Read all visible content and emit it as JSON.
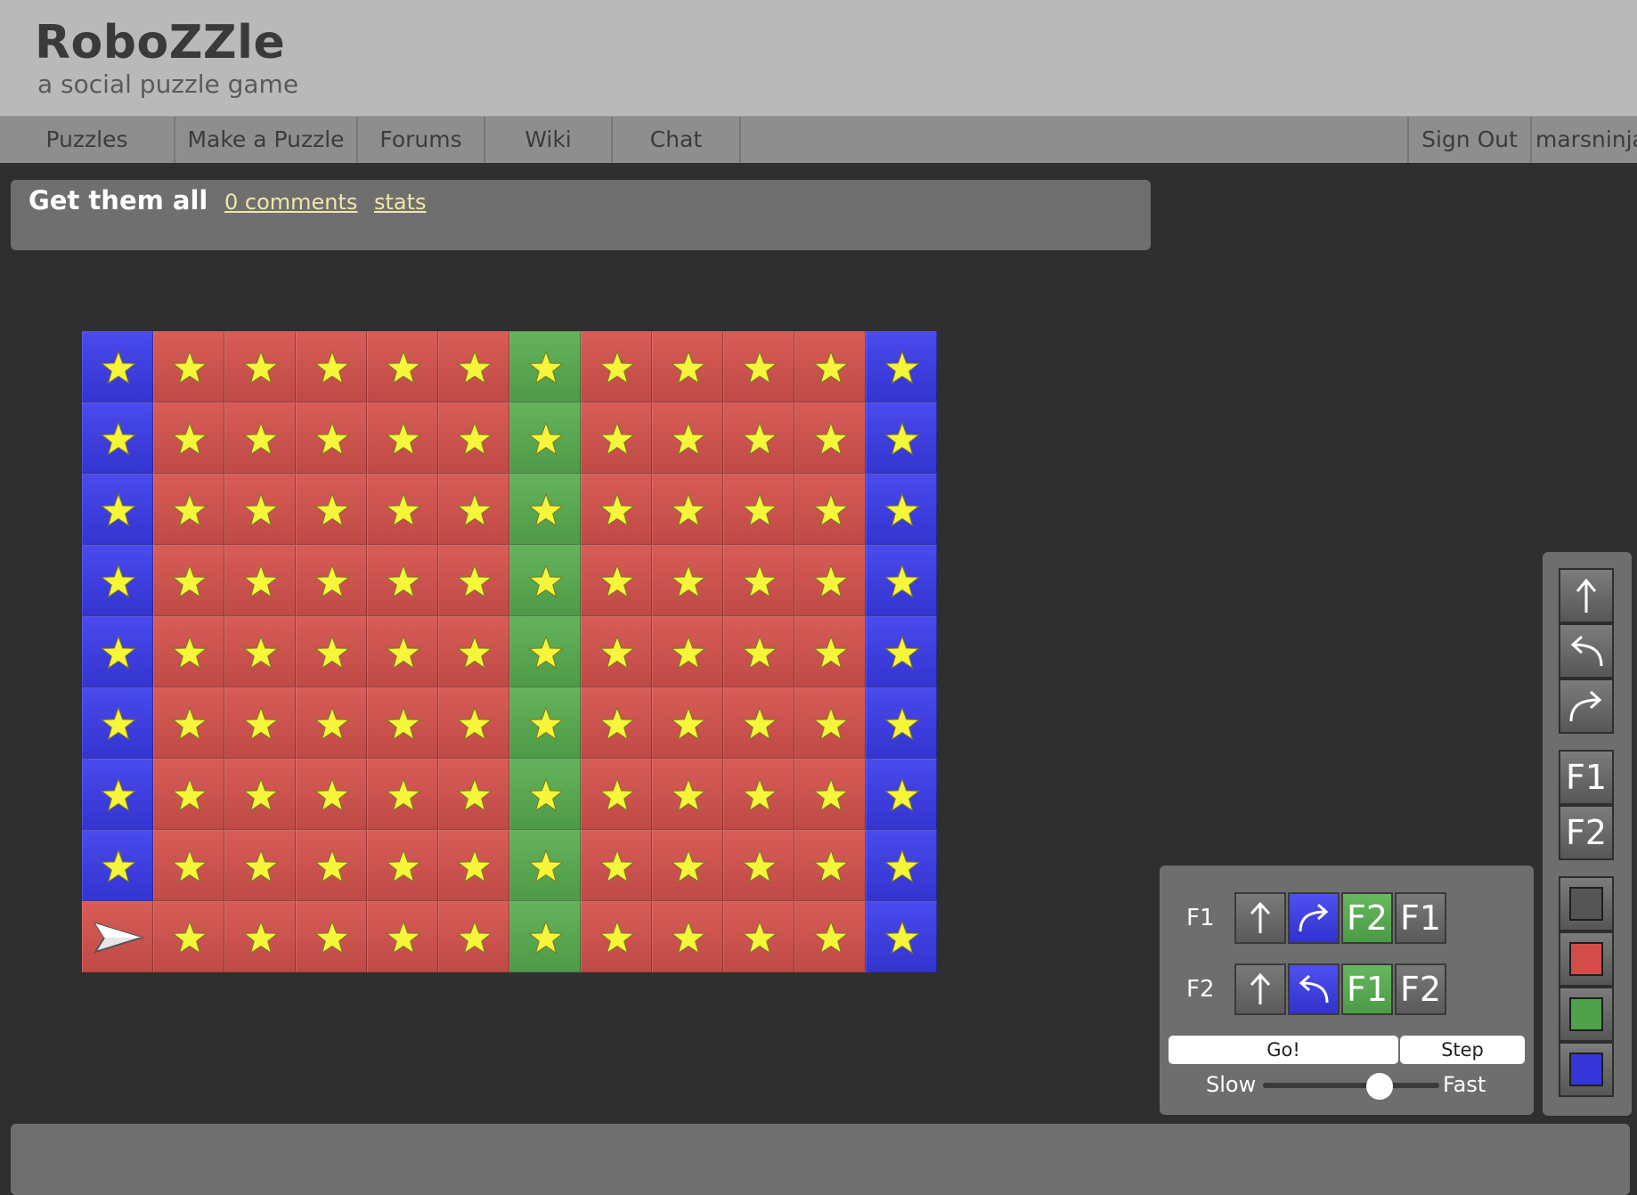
{
  "site": {
    "title": "RoboZZle",
    "subtitle": "a social puzzle game"
  },
  "nav": {
    "items": [
      "Puzzles",
      "Make a Puzzle",
      "Forums",
      "Wiki",
      "Chat"
    ],
    "sign_out": "Sign Out",
    "username": "marsninja"
  },
  "puzzle": {
    "title": "Get them all",
    "comments_link": "0 comments",
    "stats_link": "stats"
  },
  "board": {
    "rows": 9,
    "cols": 12,
    "column_colors": [
      "blue",
      "red",
      "red",
      "red",
      "red",
      "red",
      "green",
      "red",
      "red",
      "red",
      "red",
      "blue"
    ],
    "bottom_left_color": "red",
    "robot": {
      "row": 8,
      "col": 0,
      "facing": "right"
    },
    "stars": "all cells except robot start"
  },
  "program": {
    "functions": [
      {
        "label": "F1",
        "slots": [
          {
            "cmd": "forward",
            "color": "gray",
            "text": ""
          },
          {
            "cmd": "turn-right",
            "color": "blue",
            "text": ""
          },
          {
            "cmd": "call",
            "color": "green",
            "text": "F2"
          },
          {
            "cmd": "call",
            "color": "gray",
            "text": "F1"
          }
        ]
      },
      {
        "label": "F2",
        "slots": [
          {
            "cmd": "forward",
            "color": "gray",
            "text": ""
          },
          {
            "cmd": "turn-left",
            "color": "blue",
            "text": ""
          },
          {
            "cmd": "call",
            "color": "green",
            "text": "F1"
          },
          {
            "cmd": "call",
            "color": "gray",
            "text": "F2"
          }
        ]
      }
    ],
    "go_label": "Go!",
    "step_label": "Step",
    "slow_label": "Slow",
    "fast_label": "Fast",
    "speed": 0.66
  },
  "palette": {
    "f1": "F1",
    "f2": "F2",
    "colors": {
      "gray": "#555555",
      "red": "#d24d4a",
      "green": "#4fa14a",
      "blue": "#3636d8"
    }
  }
}
